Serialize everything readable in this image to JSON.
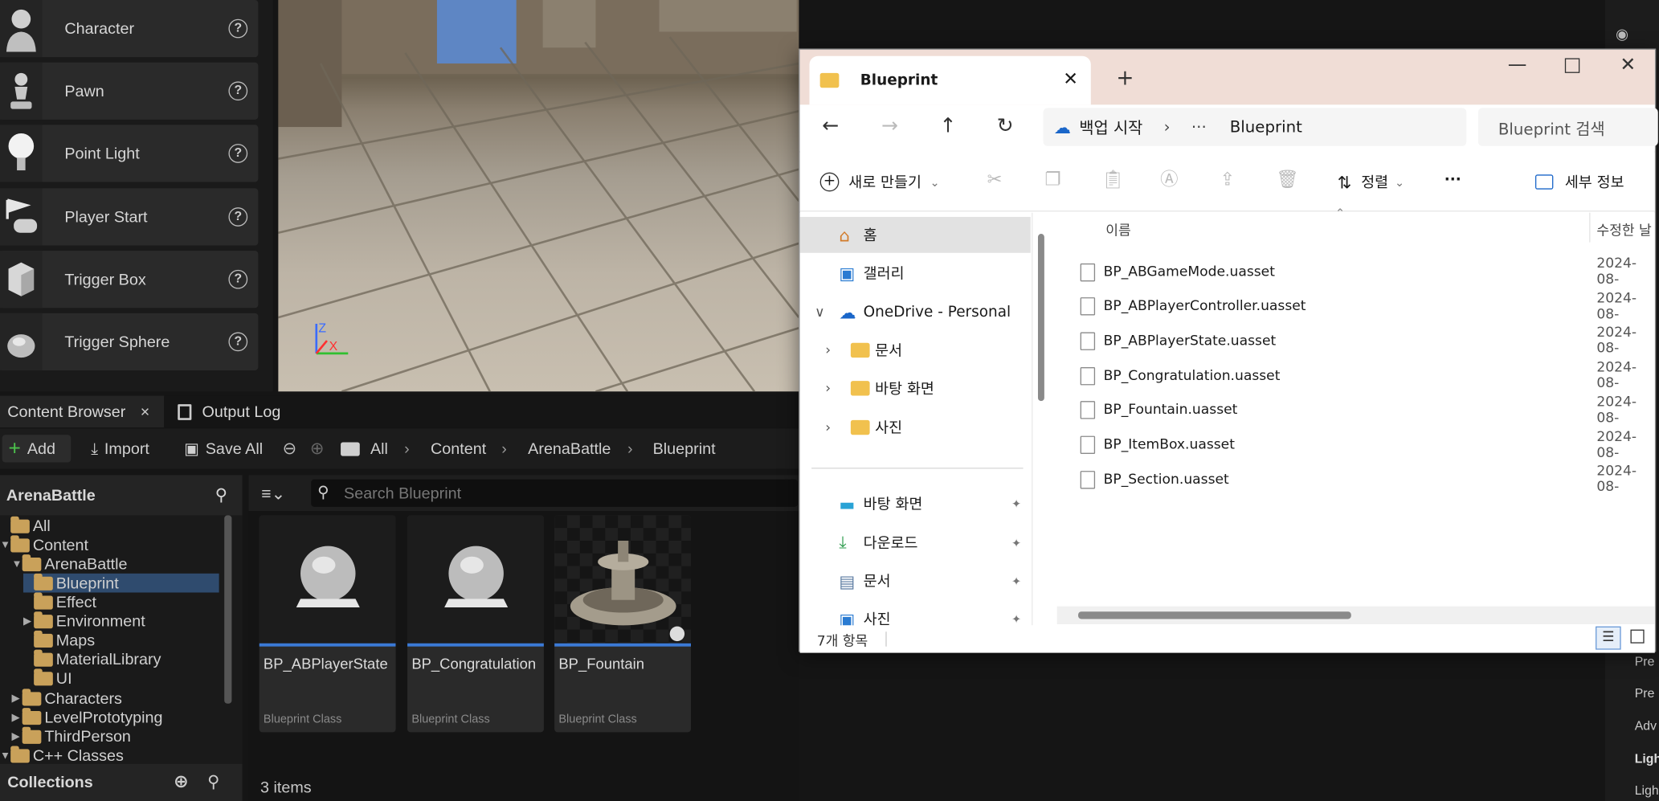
{
  "place_actors": [
    {
      "label": "Character",
      "icon": "character-icon"
    },
    {
      "label": "Pawn",
      "icon": "pawn-icon"
    },
    {
      "label": "Point Light",
      "icon": "lightbulb-icon"
    },
    {
      "label": "Player Start",
      "icon": "player-start-icon"
    },
    {
      "label": "Trigger Box",
      "icon": "cube-icon"
    },
    {
      "label": "Trigger Sphere",
      "icon": "sphere-icon"
    }
  ],
  "help_glyph": "?",
  "viewport": {
    "axis_z": "Z",
    "axis_x": "X"
  },
  "content_browser": {
    "tab_label": "Content Browser",
    "tab_close": "×",
    "output_log_label": "Output Log",
    "add_label": "Add",
    "import_label": "Import",
    "save_all_label": "Save All",
    "breadcrumb": [
      "All",
      "Content",
      "ArenaBattle",
      "Blueprint"
    ],
    "tree_title": "ArenaBattle",
    "tree": [
      {
        "label": "All",
        "depth": 0,
        "arrow": ""
      },
      {
        "label": "Content",
        "depth": 0,
        "arrow": "▼"
      },
      {
        "label": "ArenaBattle",
        "depth": 1,
        "arrow": "▼"
      },
      {
        "label": "Blueprint",
        "depth": 2,
        "arrow": "",
        "selected": true
      },
      {
        "label": "Effect",
        "depth": 2,
        "arrow": ""
      },
      {
        "label": "Environment",
        "depth": 2,
        "arrow": "▶"
      },
      {
        "label": "Maps",
        "depth": 2,
        "arrow": ""
      },
      {
        "label": "MaterialLibrary",
        "depth": 2,
        "arrow": ""
      },
      {
        "label": "UI",
        "depth": 2,
        "arrow": ""
      },
      {
        "label": "Characters",
        "depth": 1,
        "arrow": "▶"
      },
      {
        "label": "LevelPrototyping",
        "depth": 1,
        "arrow": "▶"
      },
      {
        "label": "ThirdPerson",
        "depth": 1,
        "arrow": "▶"
      },
      {
        "label": "C++ Classes",
        "depth": 0,
        "arrow": "▼"
      }
    ],
    "collections_label": "Collections",
    "search_placeholder": "Search Blueprint",
    "assets": [
      {
        "name": "BP_ABPlayerState",
        "class": "Blueprint Class",
        "thumb": "sphere-thumb-icon"
      },
      {
        "name": "BP_Congratulation",
        "class": "Blueprint Class",
        "thumb": "sphere-thumb-icon"
      },
      {
        "name": "BP_Fountain",
        "class": "Blueprint Class",
        "thumb": "fountain-thumb-icon"
      }
    ],
    "items_count": "3 items"
  },
  "explorer": {
    "tab_title": "Blueprint",
    "address_root": "백업 시작",
    "address_more": "···",
    "address_current": "Blueprint",
    "search_placeholder": "Blueprint 검색",
    "new_label": "새로 만들기",
    "sort_label": "정렬",
    "more_label": "···",
    "details_label": "세부 정보",
    "nav": [
      {
        "label": "홈",
        "icon": "home-icon",
        "selected": true
      },
      {
        "label": "갤러리",
        "icon": "gallery-icon"
      },
      {
        "label": "OneDrive - Personal",
        "icon": "cloud-icon",
        "arrow": "∨"
      },
      {
        "label": "문서",
        "icon": "folder-icon",
        "arrow": "›"
      },
      {
        "label": "바탕 화면",
        "icon": "folder-icon",
        "arrow": "›"
      },
      {
        "label": "사진",
        "icon": "folder-icon",
        "arrow": "›"
      },
      {
        "label": "바탕 화면",
        "icon": "desktop-icon",
        "pinned": true
      },
      {
        "label": "다운로드",
        "icon": "download-icon",
        "pinned": true
      },
      {
        "label": "문서",
        "icon": "document-icon",
        "pinned": true
      },
      {
        "label": "사진",
        "icon": "picture-icon",
        "pinned": true
      }
    ],
    "col_name": "이름",
    "col_modified": "수정한 날",
    "files": [
      {
        "name": "BP_ABGameMode.uasset",
        "date": "2024-08-"
      },
      {
        "name": "BP_ABPlayerController.uasset",
        "date": "2024-08-"
      },
      {
        "name": "BP_ABPlayerState.uasset",
        "date": "2024-08-"
      },
      {
        "name": "BP_Congratulation.uasset",
        "date": "2024-08-"
      },
      {
        "name": "BP_Fountain.uasset",
        "date": "2024-08-"
      },
      {
        "name": "BP_ItemBox.uasset",
        "date": "2024-08-"
      },
      {
        "name": "BP_Section.uasset",
        "date": "2024-08-"
      }
    ],
    "status": "7개 항목"
  },
  "ue_right": [
    "Pre",
    "Pre",
    "Adv",
    "Ligh",
    "Ligh"
  ]
}
